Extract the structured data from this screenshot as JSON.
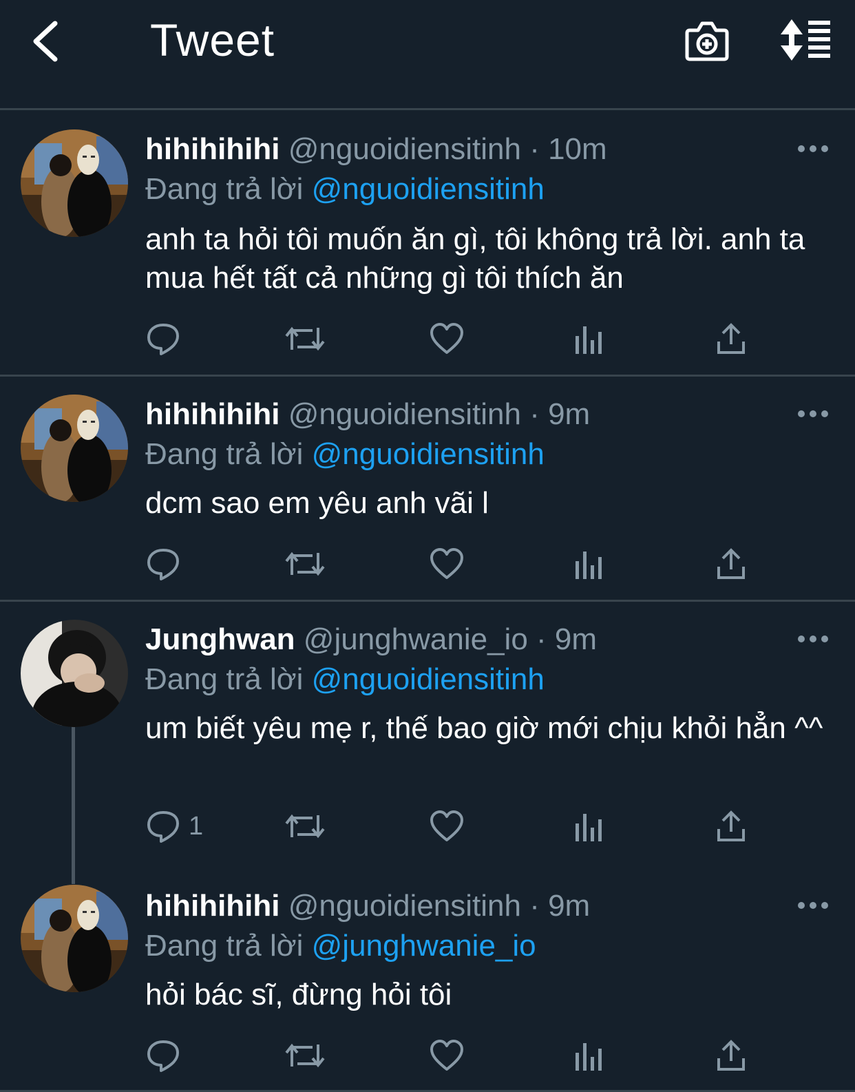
{
  "header": {
    "title": "Tweet"
  },
  "colors": {
    "background": "#15202b",
    "divider": "#38444d",
    "secondary_text": "#8899a6",
    "link": "#1da1f2"
  },
  "tweets": [
    {
      "display_name": "hihihihihi",
      "meta": "@nguoidiensitinh · 10m",
      "reply_prefix": "Đang trả lời",
      "reply_to": "@nguoidiensitinh",
      "text": "anh ta hỏi tôi muốn ăn gì, tôi không trả lời. anh ta mua hết tất cả những gì tôi thích ăn",
      "reply_count": ""
    },
    {
      "display_name": "hihihihihi",
      "meta": "@nguoidiensitinh · 9m",
      "reply_prefix": "Đang trả lời",
      "reply_to": "@nguoidiensitinh",
      "text": "dcm sao em yêu anh vãi l",
      "reply_count": ""
    },
    {
      "display_name": "Junghwan",
      "meta": "@junghwanie_io · 9m",
      "reply_prefix": "Đang trả lời",
      "reply_to": "@nguoidiensitinh",
      "text": "um biết yêu mẹ r, thế bao giờ mới chịu khỏi hẳn ^^",
      "reply_count": "1"
    },
    {
      "display_name": "hihihihihi",
      "meta": "@nguoidiensitinh · 9m",
      "reply_prefix": "Đang trả lời",
      "reply_to": "@junghwanie_io",
      "text": "hỏi bác sĩ, đừng hỏi tôi",
      "reply_count": ""
    }
  ]
}
